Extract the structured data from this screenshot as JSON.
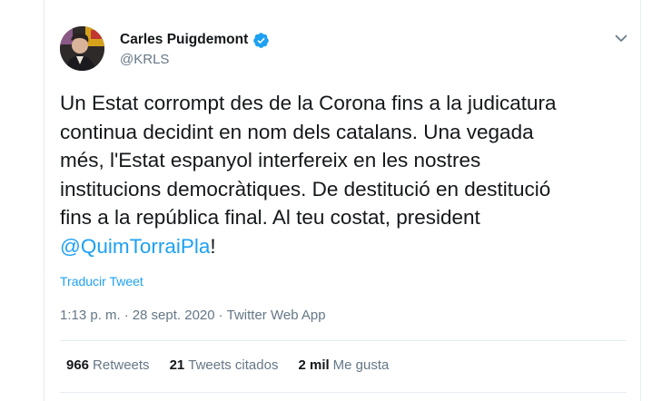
{
  "author": {
    "display_name": "Carles Puigdemont",
    "handle": "@KRLS",
    "verified": true,
    "avatar_icon": "profile-photo"
  },
  "tweet": {
    "lines": [
      "Un Estat corrompt des de la Corona fins a la judicatura",
      "continua decidint en nom dels catalans. Una vegada",
      "més, l'Estat espanyol interfereix en les nostres",
      "institucions democràtiques. De destitució en destitució",
      "fins a la república final. Al teu costat, president"
    ],
    "mention": "@QuimTorraiPla",
    "trailing": "!"
  },
  "translate_label": "Traducir Tweet",
  "meta": {
    "time": "1:13 p. m.",
    "separator": "·",
    "date": "28 sept. 2020",
    "source": "Twitter Web App"
  },
  "stats": {
    "retweets": {
      "count": "966",
      "label": "Retweets"
    },
    "quotes": {
      "count": "21",
      "label": "Tweets citados"
    },
    "likes": {
      "count": "2 mil",
      "label": "Me gusta"
    }
  },
  "colors": {
    "accent": "#1da1f2",
    "secondary_text": "#657786",
    "primary_text": "#14171a",
    "border": "#e6ecf0"
  }
}
